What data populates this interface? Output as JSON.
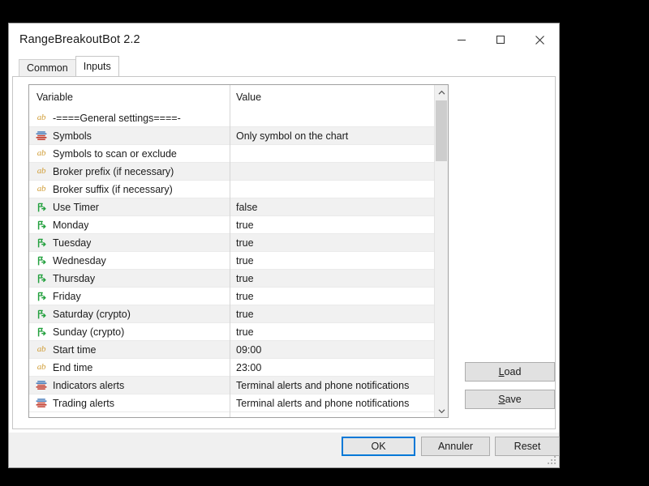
{
  "window": {
    "title": "RangeBreakoutBot 2.2",
    "caption_buttons": [
      {
        "name": "minimize",
        "glyph": "minimize-icon"
      },
      {
        "name": "maximize",
        "glyph": "maximize-icon"
      },
      {
        "name": "close",
        "glyph": "close-icon"
      }
    ]
  },
  "tabs": [
    {
      "label": "Common",
      "active": false
    },
    {
      "label": "Inputs",
      "active": true
    }
  ],
  "grid": {
    "headers": {
      "variable": "Variable",
      "value": "Value"
    },
    "rows": [
      {
        "icon": "string-type-icon",
        "variable": "-====General settings====-",
        "value": ""
      },
      {
        "icon": "enum-type-icon",
        "variable": "Symbols",
        "value": "Only symbol on the chart"
      },
      {
        "icon": "string-type-icon",
        "variable": "Symbols to scan or exclude",
        "value": ""
      },
      {
        "icon": "string-type-icon",
        "variable": "Broker prefix (if necessary)",
        "value": ""
      },
      {
        "icon": "string-type-icon",
        "variable": "Broker suffix (if necessary)",
        "value": ""
      },
      {
        "icon": "bool-type-icon",
        "variable": "Use Timer",
        "value": "false"
      },
      {
        "icon": "bool-type-icon",
        "variable": "Monday",
        "value": "true"
      },
      {
        "icon": "bool-type-icon",
        "variable": "Tuesday",
        "value": "true"
      },
      {
        "icon": "bool-type-icon",
        "variable": "Wednesday",
        "value": "true"
      },
      {
        "icon": "bool-type-icon",
        "variable": "Thursday",
        "value": "true"
      },
      {
        "icon": "bool-type-icon",
        "variable": "Friday",
        "value": "true"
      },
      {
        "icon": "bool-type-icon",
        "variable": "Saturday (crypto)",
        "value": "true"
      },
      {
        "icon": "bool-type-icon",
        "variable": "Sunday (crypto)",
        "value": "true"
      },
      {
        "icon": "string-type-icon",
        "variable": "Start time",
        "value": "09:00"
      },
      {
        "icon": "string-type-icon",
        "variable": "End time",
        "value": "23:00"
      },
      {
        "icon": "enum-type-icon",
        "variable": "Indicators alerts",
        "value": "Terminal alerts and phone notifications"
      },
      {
        "icon": "enum-type-icon",
        "variable": "Trading alerts",
        "value": "Terminal alerts and phone notifications"
      }
    ]
  },
  "side_buttons": {
    "load": {
      "prefix": "",
      "mnemonic": "L",
      "suffix": "oad"
    },
    "save": {
      "prefix": "",
      "mnemonic": "S",
      "suffix": "ave"
    }
  },
  "bottom_buttons": {
    "ok": "OK",
    "cancel": "Annuler",
    "reset": "Reset"
  },
  "colors": {
    "accent": "#0078d7",
    "string_icon": "#d2a03c",
    "bool_icon": "#23a03e",
    "enum_icon_top": "#4a7ebb",
    "enum_icon_bottom": "#c0392b",
    "row_alt": "#f1f1f1",
    "window_chrome": "#f0f0f0"
  }
}
